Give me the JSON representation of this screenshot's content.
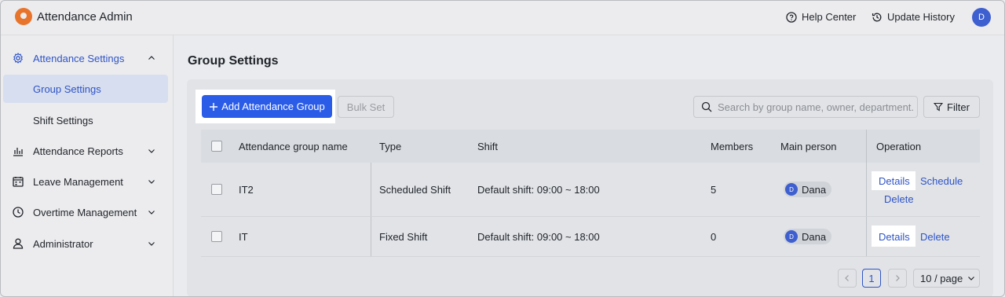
{
  "app": {
    "title": "Attendance Admin",
    "help_center": "Help Center",
    "update_history": "Update History",
    "user_initial": "D"
  },
  "sidebar": {
    "items": [
      {
        "label": "Attendance Settings",
        "icon": "gear-icon",
        "expanded": true,
        "active_parent": true
      },
      {
        "label": "Group Settings",
        "active": true
      },
      {
        "label": "Shift Settings"
      },
      {
        "label": "Attendance Reports",
        "icon": "bar-chart-icon"
      },
      {
        "label": "Leave Management",
        "icon": "calendar-icon"
      },
      {
        "label": "Overtime Management",
        "icon": "clock-icon"
      },
      {
        "label": "Administrator",
        "icon": "user-icon"
      }
    ]
  },
  "page": {
    "title": "Group Settings"
  },
  "toolbar": {
    "add_group": "Add Attendance Group",
    "bulk_set": "Bulk Set",
    "search_placeholder": "Search by group name, owner, department...",
    "filter": "Filter"
  },
  "table": {
    "columns": [
      "Attendance group name",
      "Type",
      "Shift",
      "Members",
      "Main person",
      "Operation"
    ],
    "rows": [
      {
        "name": "IT2",
        "type": "Scheduled Shift",
        "shift": "Default shift: 09:00 ~ 18:00",
        "members": "5",
        "main_person": "Dana",
        "main_person_initial": "D",
        "ops": [
          "Details",
          "Schedule",
          "Delete"
        ]
      },
      {
        "name": "IT",
        "type": "Fixed Shift",
        "shift": "Default shift: 09:00 ~ 18:00",
        "members": "0",
        "main_person": "Dana",
        "main_person_initial": "D",
        "ops": [
          "Details",
          "Delete"
        ]
      }
    ]
  },
  "pagination": {
    "current_page": "1",
    "page_size": "10 / page"
  },
  "colors": {
    "accent": "#2a5ce8",
    "link": "#2f54c7",
    "brand": "#e8742c"
  }
}
